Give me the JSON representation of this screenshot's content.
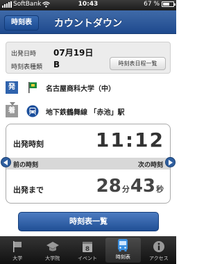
{
  "status": {
    "carrier": "SoftBank",
    "time": "10:43",
    "battery": "67 %",
    "battery_level": 0.67
  },
  "nav": {
    "back_label": "時刻表",
    "title": "カウントダウン"
  },
  "info": {
    "date_label": "出発日時",
    "date_value": "07月19日",
    "type_label": "時刻表種類",
    "type_value": "B",
    "schedule_button": "時刻表日程一覧"
  },
  "route": {
    "from_badge": "発",
    "from_name": "名古屋商科大学（中）",
    "to_badge": "着",
    "to_name": "地下鉄鶴舞線 「赤池」駅"
  },
  "countdown": {
    "departure_label": "出発時刻",
    "departure_time": "11:12",
    "prev_label": "前の時刻",
    "next_label": "次の時刻",
    "until_label": "出発まで",
    "minutes": "28",
    "minutes_unit": "分",
    "seconds": "43",
    "seconds_unit": "秒"
  },
  "list_button": "時刻表一覧",
  "tabs": [
    {
      "label": "大学",
      "icon": "flag-icon"
    },
    {
      "label": "大学院",
      "icon": "graduation-cap-icon"
    },
    {
      "label": "イベント",
      "icon": "calendar-icon"
    },
    {
      "label": "時刻表",
      "icon": "bus-icon",
      "active": true
    },
    {
      "label": "アクセス",
      "icon": "info-icon"
    }
  ]
}
